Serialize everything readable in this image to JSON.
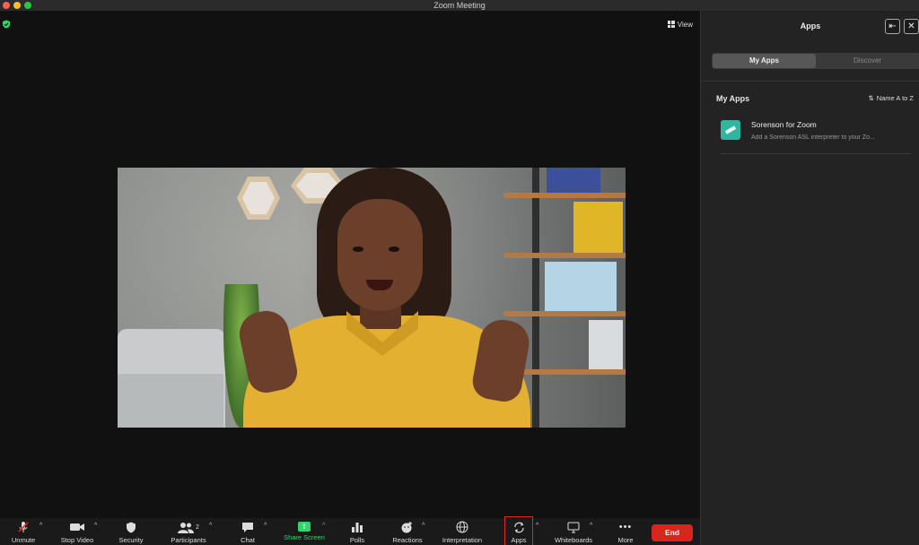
{
  "window": {
    "title": "Zoom Meeting"
  },
  "meeting": {
    "view_label": "View"
  },
  "panel": {
    "title": "Apps",
    "tabs": [
      {
        "label": "My Apps",
        "active": true
      },
      {
        "label": "Discover",
        "active": false
      }
    ],
    "section_title": "My Apps",
    "sort_label": "Name A to Z",
    "apps": [
      {
        "name": "Sorenson for Zoom",
        "description": "Add a Sorenson ASL interpreter to your Zo...",
        "icon": "sorenson-icon"
      }
    ]
  },
  "toolbar": {
    "items": [
      {
        "id": "unmute",
        "label": "Unmute",
        "icon": "microphone-muted-icon"
      },
      {
        "id": "stop-video",
        "label": "Stop Video",
        "icon": "video-camera-icon"
      },
      {
        "id": "security",
        "label": "Security",
        "icon": "shield-icon"
      },
      {
        "id": "participants",
        "label": "Participants",
        "icon": "people-icon",
        "count": "2"
      },
      {
        "id": "chat",
        "label": "Chat",
        "icon": "chat-bubble-icon"
      },
      {
        "id": "share-screen",
        "label": "Share Screen",
        "icon": "share-arrow-icon"
      },
      {
        "id": "polls",
        "label": "Polls",
        "icon": "bar-chart-icon"
      },
      {
        "id": "reactions",
        "label": "Reactions",
        "icon": "emoji-plus-icon"
      },
      {
        "id": "interpretation",
        "label": "Interpretation",
        "icon": "globe-icon"
      },
      {
        "id": "apps",
        "label": "Apps",
        "icon": "apps-icon"
      },
      {
        "id": "whiteboards",
        "label": "Whiteboards",
        "icon": "whiteboard-icon"
      },
      {
        "id": "more",
        "label": "More",
        "icon": "ellipsis-icon"
      }
    ],
    "end_label": "End"
  },
  "colors": {
    "accent_green": "#2fd66b",
    "end_red": "#d9261c",
    "highlight_red": "#e0271f"
  }
}
